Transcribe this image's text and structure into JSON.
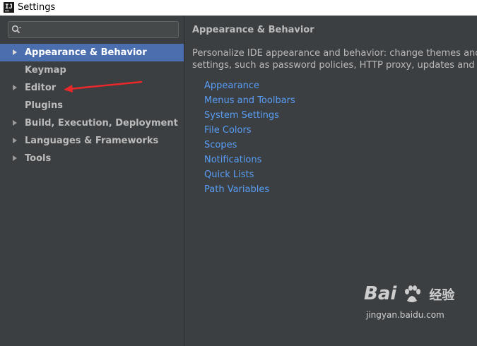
{
  "window": {
    "title": "Settings",
    "app_icon_label": "IJ"
  },
  "search": {
    "placeholder": ""
  },
  "tree": [
    {
      "label": "Appearance & Behavior",
      "has_children": true,
      "selected": true
    },
    {
      "label": "Keymap",
      "has_children": false
    },
    {
      "label": "Editor",
      "has_children": true
    },
    {
      "label": "Plugins",
      "has_children": false
    },
    {
      "label": "Build, Execution, Deployment",
      "has_children": true
    },
    {
      "label": "Languages & Frameworks",
      "has_children": true
    },
    {
      "label": "Tools",
      "has_children": true
    }
  ],
  "content": {
    "heading": "Appearance & Behavior",
    "description_line1": "Personalize IDE appearance and behavior: change themes and font s",
    "description_line2": "settings, such as password policies, HTTP proxy, updates and more.",
    "links": [
      "Appearance",
      "Menus and Toolbars",
      "System Settings",
      "File Colors",
      "Scopes",
      "Notifications",
      "Quick Lists",
      "Path Variables"
    ]
  },
  "watermark": {
    "logo_text": "Bai",
    "logo_text2": "经验",
    "url": "jingyan.baidu.com"
  },
  "colors": {
    "selection": "#4b6eaf",
    "link": "#589df6",
    "annotation_arrow": "#e8282b",
    "background": "#3c3f41"
  }
}
